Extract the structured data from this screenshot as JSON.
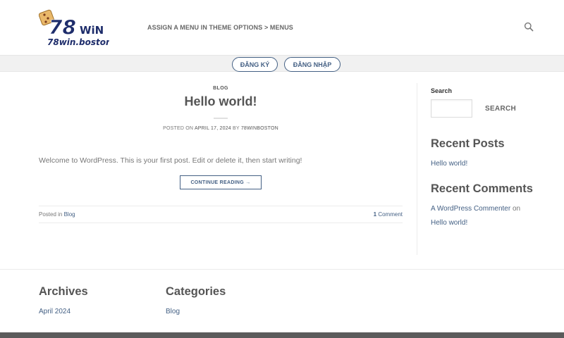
{
  "header": {
    "logo_number": "78",
    "logo_word": "WiN",
    "logo_domain": "78win.boston",
    "menu_note": "ASSIGN A MENU IN THEME OPTIONS > MENUS"
  },
  "subbar": {
    "register_label": "ĐĂNG KÝ",
    "login_label": "ĐĂNG NHẬP"
  },
  "post": {
    "category": "BLOG",
    "title": "Hello world!",
    "meta_prefix": "POSTED ON ",
    "date": "APRIL 17, 2024",
    "meta_by": " BY ",
    "author": "78WINBOSTON",
    "excerpt": "Welcome to WordPress. This is your first post. Edit or delete it, then start writing!",
    "read_more": "CONTINUE READING →",
    "posted_in_prefix": "Posted in ",
    "posted_in_category": "Blog",
    "comment_count": "1",
    "comment_word": " Comment"
  },
  "sidebar": {
    "search_label": "Search",
    "search_value": "",
    "search_button": "SEARCH",
    "recent_posts_title": "Recent Posts",
    "recent_post_link": "Hello world!",
    "recent_comments_title": "Recent Comments",
    "commenter": "A WordPress Commenter",
    "on_word": " on",
    "commented_post": "Hello world!"
  },
  "footer": {
    "archives_title": "Archives",
    "archives_link": "April 2024",
    "categories_title": "Categories",
    "categories_link": "Blog"
  },
  "colors": {
    "accent": "#446084",
    "text": "#555555",
    "subbar_bg": "#f1f1f1",
    "footer_bar": "#5b5b5b"
  },
  "icons": {
    "header_search": "search-icon",
    "logo_emblem": "dice-icon"
  }
}
